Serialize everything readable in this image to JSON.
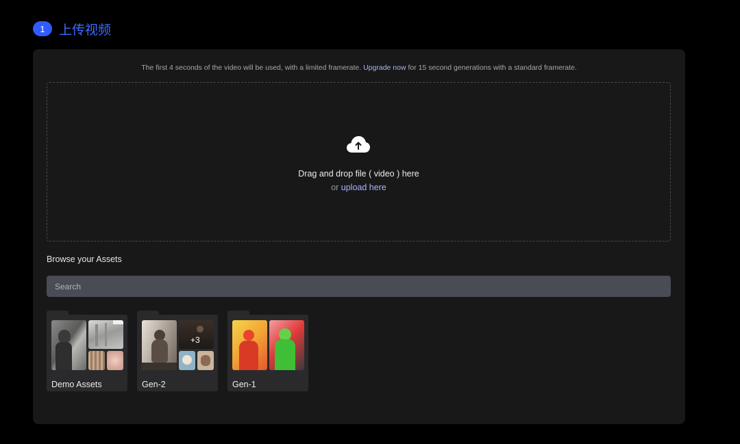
{
  "step": {
    "number": "1",
    "title": "上传视频"
  },
  "notice": {
    "before": "The first 4 seconds of the video will be used, with a limited framerate. ",
    "link": "Upgrade now",
    "after": " for 15 second generations with a standard framerate."
  },
  "dropzone": {
    "icon": "cloud-upload-icon",
    "main_text": "Drag and drop file ( video ) here",
    "or_text": "or ",
    "upload_link": "upload here"
  },
  "assets": {
    "title": "Browse your Assets",
    "search_placeholder": "Search",
    "folders": [
      {
        "label": "Demo Assets"
      },
      {
        "label": "Gen-2",
        "more_count": "+3"
      },
      {
        "label": "Gen-1"
      }
    ]
  },
  "colors": {
    "accent": "#2f5bff",
    "link": "#a9b4ff",
    "panel": "#181818",
    "background": "#000000"
  }
}
